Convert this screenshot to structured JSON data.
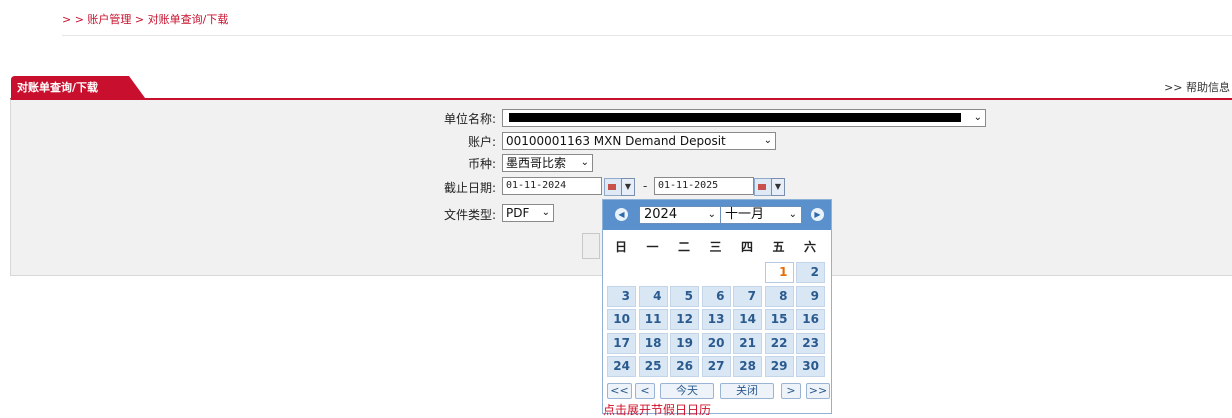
{
  "breadcrumb": "> > 账户管理 > 对账单查询/下载",
  "tab_title": "对账单查询/下载",
  "help_link": ">> 帮助信息",
  "form": {
    "unit_name_label": "单位名称:",
    "account_label": "账户:",
    "account_value": "00100001163 MXN Demand Deposit",
    "currency_label": "币种:",
    "currency_value": "墨西哥比索",
    "end_date_label": "截止日期:",
    "start_date": "01-11-2024",
    "date_separator": "-",
    "end_date": "01-11-2025",
    "file_type_label": "文件类型:",
    "file_type_value": "PDF"
  },
  "calendar": {
    "year": "2024",
    "month": "十一月",
    "weekdays": [
      "日",
      "一",
      "二",
      "三",
      "四",
      "五",
      "六"
    ],
    "days": [
      "1",
      "2",
      "3",
      "4",
      "5",
      "6",
      "7",
      "8",
      "9",
      "10",
      "11",
      "12",
      "13",
      "14",
      "15",
      "16",
      "17",
      "18",
      "19",
      "20",
      "21",
      "22",
      "23",
      "24",
      "25",
      "26",
      "27",
      "28",
      "29",
      "30"
    ],
    "buttons": {
      "prev_year": "<<",
      "prev_month": "<",
      "today": "今天",
      "close": "关闭",
      "next_month": ">",
      "next_year": ">>"
    },
    "holiday_link": "点击展开节假日日历"
  },
  "colors": {
    "brand_red": "#c8102e",
    "calendar_blue": "#5a91cc",
    "day_cell": "#d9e6f4",
    "today_text": "#e36c0a"
  }
}
